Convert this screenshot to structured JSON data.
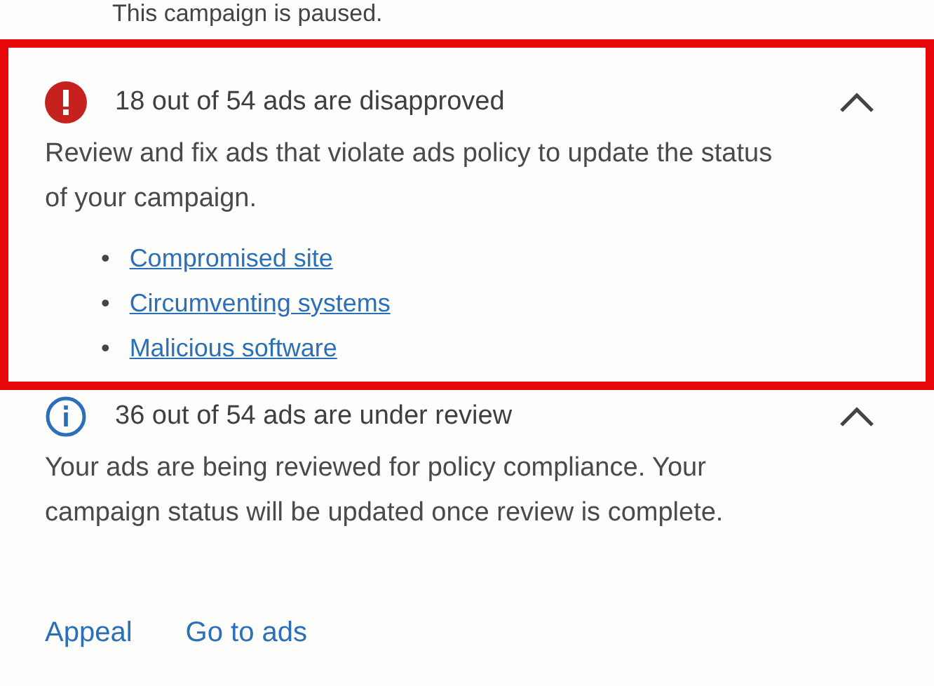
{
  "status_text": "This campaign is paused.",
  "alerts": [
    {
      "kind": "error",
      "highlighted": true,
      "expanded": true,
      "title": "18 out of 54 ads are disapproved",
      "body": "Review and fix ads that violate ads policy to update the status of your campaign.",
      "bullet": "•",
      "links": [
        "Compromised site",
        "Circumventing systems",
        "Malicious software"
      ]
    },
    {
      "kind": "info",
      "highlighted": false,
      "expanded": true,
      "title": "36 out of 54 ads are under review",
      "body": "Your ads are being reviewed for policy compliance. Your campaign status will be updated once review is complete."
    }
  ],
  "actions": [
    "Appeal",
    "Go to ads"
  ]
}
